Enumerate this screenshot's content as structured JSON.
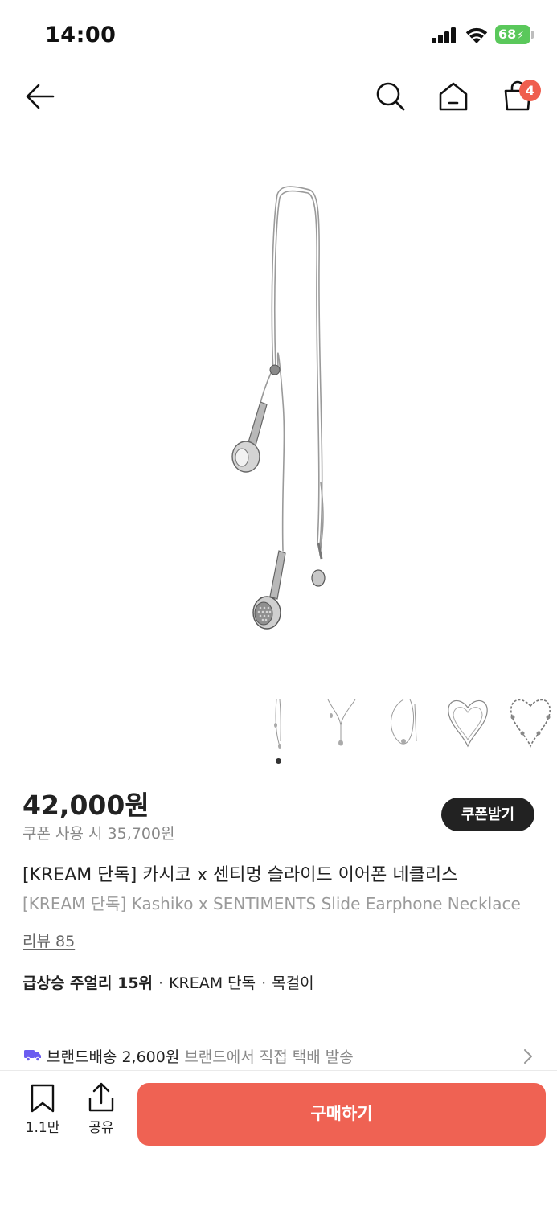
{
  "status_bar": {
    "time": "14:00",
    "battery": "68"
  },
  "nav": {
    "cart_count": "4"
  },
  "product": {
    "price": "42,000원",
    "coupon_price": "쿠폰 사용 시 35,700원",
    "coupon_button": "쿠폰받기",
    "title_ko": "[KREAM 단독] 카시코 x 센티멍 슬라이드 이어폰 네클리스",
    "title_en": "[KREAM 단독] Kashiko x SENTIMENTS Slide Earphone Necklace",
    "review": "리뷰 85",
    "tags": [
      "급상승 주얼리 15위",
      "KREAM 단독",
      "목걸이"
    ],
    "tag_separator": "·"
  },
  "delivery": {
    "label": "브랜드배송 2,600원",
    "sub": "브랜드에서 직접 택배 발송"
  },
  "bottom_bar": {
    "bookmark_count": "1.1만",
    "share_label": "공유",
    "buy_label": "구매하기"
  },
  "colors": {
    "accent": "#ef6253",
    "badge": "#ef5e4e",
    "battery": "#5ac85b",
    "delivery_truck": "#6b5cf0"
  },
  "icons": [
    "back-arrow-icon",
    "search-icon",
    "home-icon",
    "cart-icon",
    "truck-icon",
    "chevron-right-icon",
    "bookmark-icon",
    "share-icon"
  ]
}
